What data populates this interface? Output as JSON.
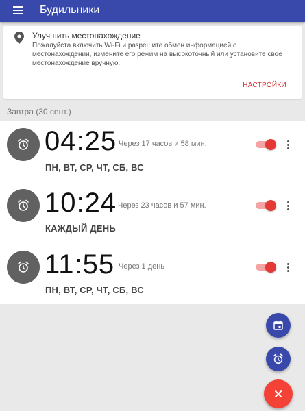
{
  "appbar": {
    "title": "Будильники",
    "menu_icon": "menu-icon"
  },
  "location_card": {
    "title": "Улучшить местонахождение",
    "body": "Пожалуйста включить Wi-Fi и  разрешите обмен информацией о местонахождении, измените его режим на высокоточный или установите свое местонахождение вручную.",
    "action": "НАСТРОЙКИ"
  },
  "section": {
    "label": "Завтра (30 сент.)"
  },
  "alarms": [
    {
      "time": "04:25",
      "remaining": "Через 17 часов и 58 мин.",
      "days": "ПН, ВТ, СР, ЧТ, СБ, ВС",
      "enabled": true
    },
    {
      "time": "10:24",
      "remaining": "Через 23 часов и 57 мин.",
      "days": "КАЖДЫЙ ДЕНЬ",
      "enabled": true
    },
    {
      "time": "11:55",
      "remaining": "Через 1 день",
      "days": "ПН, ВТ, СР, ЧТ, СБ, ВС",
      "enabled": true
    }
  ],
  "fabs": {
    "calendar_icon": "calendar-icon",
    "alarm_icon": "alarm-clock-icon",
    "close_icon": "close-icon"
  },
  "colors": {
    "primary": "#3949ab",
    "accent": "#f44336",
    "toggle_on": "#e53935"
  }
}
